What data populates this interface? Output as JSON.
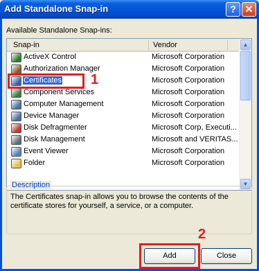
{
  "window": {
    "title": "Add Standalone Snap-in",
    "help_glyph": "?",
    "close_glyph": "✕"
  },
  "available_label": "Available Standalone Snap-ins:",
  "columns": {
    "snapin": "Snap-in",
    "vendor": "Vendor"
  },
  "rows": [
    {
      "name": "ActiveX Control",
      "vendor": "Microsoft Corporation",
      "icon": "activex-icon",
      "color": "#2d7a2d"
    },
    {
      "name": "Authorization Manager",
      "vendor": "Microsoft Corporation",
      "icon": "authorization-manager-icon",
      "color": "#8a5a2b"
    },
    {
      "name": "Certificates",
      "vendor": "Microsoft Corporation",
      "icon": "certificates-icon",
      "color": "#3a5fb0",
      "selected": true
    },
    {
      "name": "Component Services",
      "vendor": "Microsoft Corporation",
      "icon": "component-services-icon",
      "color": "#3e7d3e"
    },
    {
      "name": "Computer Management",
      "vendor": "Microsoft Corporation",
      "icon": "computer-management-icon",
      "color": "#4a6fa8"
    },
    {
      "name": "Device Manager",
      "vendor": "Microsoft Corporation",
      "icon": "device-manager-icon",
      "color": "#4a6fa8"
    },
    {
      "name": "Disk Defragmenter",
      "vendor": "Microsoft Corp, Executi...",
      "icon": "disk-defragmenter-icon",
      "color": "#c0392b"
    },
    {
      "name": "Disk Management",
      "vendor": "Microsoft and VERITAS...",
      "icon": "disk-management-icon",
      "color": "#5d6d7e"
    },
    {
      "name": "Event Viewer",
      "vendor": "Microsoft Corporation",
      "icon": "event-viewer-icon",
      "color": "#5b7fb5"
    },
    {
      "name": "Folder",
      "vendor": "Microsoft Corporation",
      "icon": "folder-icon",
      "color": "#e8c04c"
    }
  ],
  "description": {
    "legend": "Description",
    "text": "The Certificates snap-in allows you to browse the contents of the certificate stores for yourself, a service, or a computer."
  },
  "buttons": {
    "add": "Add",
    "close": "Close"
  },
  "annotations": {
    "one": "1",
    "two": "2",
    "color": "#e01e1e"
  }
}
